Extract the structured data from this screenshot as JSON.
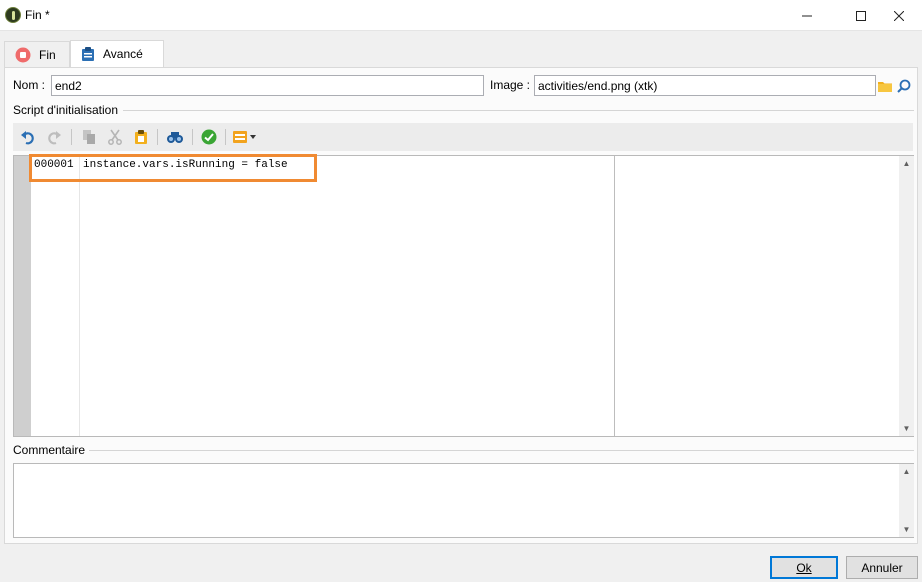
{
  "window": {
    "title": "Fin *"
  },
  "tabs": [
    {
      "label": "Fin",
      "icon": "stop-icon"
    },
    {
      "label": "Avancé",
      "icon": "clipboard-icon"
    }
  ],
  "form": {
    "name_label": "Nom :",
    "name_value": "end2",
    "image_label": "Image :",
    "image_value": "activities/end.png (xtk)"
  },
  "script_section": {
    "title": "Script d'initialisation",
    "toolbar": [
      "undo-icon",
      "redo-icon",
      "copy-icon",
      "cut-icon",
      "paste-icon",
      "find-icon",
      "check-icon",
      "insert-field-icon"
    ],
    "lines": [
      {
        "number": "000001",
        "code": "instance.vars.isRunning = false"
      }
    ]
  },
  "comment_section": {
    "title": "Commentaire"
  },
  "buttons": {
    "ok": "Ok",
    "cancel": "Annuler"
  },
  "colors": {
    "highlight": "#f08a32",
    "accent": "#0078d7"
  }
}
